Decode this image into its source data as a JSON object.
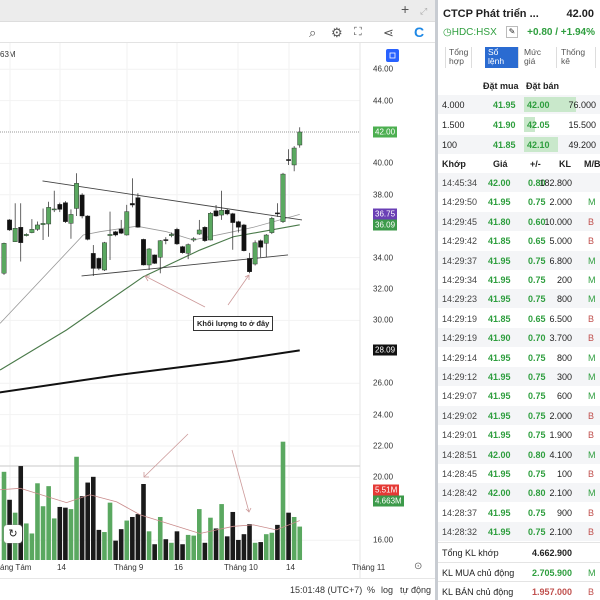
{
  "chart": {
    "volume_legend": "63M",
    "annotation": "Khối lượng to ở đây",
    "price_axis": [
      "46.00",
      "44.00",
      "40.00",
      "38.00",
      "34.00",
      "32.00",
      "30.00",
      "26.00",
      "24.00",
      "22.00",
      "20.00",
      "16.00"
    ],
    "price_axis_values": [
      46,
      44,
      40,
      38,
      34,
      32,
      30,
      26,
      24,
      22,
      20,
      16
    ],
    "badges": [
      {
        "text": "42.00",
        "value": 42.0,
        "color": "#4caf50"
      },
      {
        "text": "36.75",
        "value": 36.75,
        "color": "#6a3fb5"
      },
      {
        "text": "36.09",
        "value": 36.09,
        "color": "#3c9a4a"
      },
      {
        "text": "28.09",
        "value": 28.09,
        "color": "#111111"
      },
      {
        "text": "5.51M",
        "value": 19.2,
        "color": "#e53935"
      },
      {
        "text": "4.663M",
        "value": 18.5,
        "color": "#3c9a4a"
      }
    ],
    "x_axis": [
      "áng Tám",
      "14",
      "Tháng 9",
      "16",
      "Tháng 10",
      "14",
      "Tháng 11"
    ],
    "status": {
      "time": "15:01:48 (UTC+7)",
      "percent": "%",
      "log": "log",
      "auto": "tự động"
    }
  },
  "chart_data": {
    "type": "candlestick",
    "ohlc": [
      [
        33.0,
        34.95,
        32.9,
        34.91
      ],
      [
        36.4,
        36.45,
        35.7,
        35.76
      ],
      [
        35.01,
        37.46,
        35.0,
        35.87
      ],
      [
        35.93,
        37.46,
        33.75,
        34.95
      ],
      [
        35.4,
        35.55,
        35.35,
        35.48
      ],
      [
        35.59,
        36.45,
        35.55,
        35.8
      ],
      [
        35.8,
        36.3,
        35.7,
        36.08
      ],
      [
        36.1,
        37.13,
        35.12,
        36.18
      ],
      [
        36.14,
        37.56,
        35.33,
        37.2
      ],
      [
        37.05,
        38.26,
        36.9,
        37.1
      ],
      [
        37.39,
        37.5,
        36.9,
        37.07
      ],
      [
        37.5,
        37.6,
        36.2,
        36.29
      ],
      [
        36.18,
        37.07,
        35.2,
        36.75
      ],
      [
        37.13,
        39.37,
        36.65,
        38.73
      ],
      [
        37.99,
        38.1,
        36.5,
        36.65
      ],
      [
        36.65,
        36.7,
        35.1,
        35.16
      ],
      [
        34.27,
        34.8,
        32.83,
        33.31
      ],
      [
        33.95,
        34.0,
        33.2,
        33.31
      ],
      [
        33.21,
        35.0,
        33.15,
        34.95
      ],
      [
        35.4,
        36.93,
        33.85,
        35.48
      ],
      [
        35.65,
        35.7,
        35.35,
        35.44
      ],
      [
        35.82,
        36.4,
        35.5,
        35.55
      ],
      [
        35.44,
        37.36,
        35.4,
        36.93
      ],
      [
        37.45,
        39.05,
        37.2,
        37.35
      ],
      [
        37.82,
        38.1,
        35.9,
        35.93
      ],
      [
        35.16,
        35.2,
        33.5,
        33.53
      ],
      [
        33.53,
        34.6,
        33.21,
        34.55
      ],
      [
        34.17,
        34.2,
        33.6,
        33.63
      ],
      [
        34.02,
        35.12,
        33.0,
        35.08
      ],
      [
        35.15,
        35.3,
        34.85,
        35.08
      ],
      [
        35.4,
        35.6,
        35.3,
        35.48
      ],
      [
        35.8,
        35.9,
        34.8,
        34.87
      ],
      [
        34.7,
        34.75,
        34.25,
        34.31
      ],
      [
        34.27,
        34.9,
        33.9,
        34.83
      ],
      [
        35.12,
        35.3,
        35.0,
        35.2
      ],
      [
        35.5,
        36.4,
        35.45,
        35.76
      ],
      [
        35.93,
        36.0,
        35.0,
        35.08
      ],
      [
        35.12,
        36.9,
        35.1,
        36.82
      ],
      [
        36.98,
        37.35,
        36.6,
        36.65
      ],
      [
        36.71,
        38.26,
        36.4,
        37.02
      ],
      [
        37.02,
        37.1,
        36.7,
        36.78
      ],
      [
        36.8,
        36.85,
        34.5,
        36.23
      ],
      [
        36.29,
        36.35,
        35.6,
        35.93
      ],
      [
        36.08,
        36.15,
        34.4,
        34.44
      ],
      [
        33.95,
        34.3,
        33.0,
        33.1
      ],
      [
        33.59,
        35.1,
        33.5,
        34.95
      ],
      [
        35.08,
        35.15,
        34.02,
        34.66
      ],
      [
        34.91,
        35.5,
        34.02,
        35.44
      ],
      [
        35.59,
        36.6,
        35.5,
        36.5
      ],
      [
        36.85,
        37.46,
        36.6,
        36.78
      ],
      [
        36.29,
        39.4,
        36.2,
        39.32
      ],
      [
        40.25,
        40.9,
        39.9,
        40.18
      ],
      [
        39.9,
        41.1,
        39.5,
        40.98
      ],
      [
        41.17,
        42.3,
        41.0,
        42.0
      ]
    ],
    "volume_millions": [
      12.3,
      8.4,
      6.6,
      13.1,
      5.1,
      3.7,
      10.7,
      7.5,
      10.3,
      5.8,
      7.4,
      7.3,
      7.1,
      14.4,
      8.9,
      10.8,
      11.6,
      4.2,
      3.9,
      8.0,
      2.7,
      4.3,
      5.5,
      6.0,
      6.4,
      10.6,
      4.0,
      2.2,
      6.0,
      2.9,
      2.4,
      4.0,
      2.2,
      3.5,
      3.4,
      7.1,
      2.4,
      5.9,
      4.4,
      7.8,
      3.3,
      6.7,
      2.8,
      3.6,
      5.0,
      2.4,
      2.5,
      3.6,
      3.8,
      4.9,
      16.5,
      6.6,
      6.0,
      4.66
    ],
    "volume_up": [
      1,
      0,
      1,
      0,
      1,
      1,
      1,
      1,
      1,
      1,
      0,
      0,
      1,
      1,
      0,
      0,
      0,
      0,
      1,
      1,
      0,
      0,
      1,
      0,
      0,
      0,
      1,
      0,
      1,
      0,
      1,
      0,
      0,
      1,
      1,
      1,
      0,
      1,
      0,
      1,
      0,
      0,
      0,
      0,
      0,
      1,
      0,
      1,
      1,
      0,
      1,
      0,
      1,
      1
    ],
    "ma_short": [
      [
        -0.7,
        29.81
      ],
      [
        14.2,
        35.44
      ],
      [
        17.2,
        35.65
      ],
      [
        23.8,
        36.0
      ],
      [
        29.1,
        35.65
      ],
      [
        33.9,
        35.12
      ],
      [
        41.1,
        35.65
      ],
      [
        44.7,
        35.93
      ],
      [
        53,
        36.75
      ]
    ],
    "ma_mid": [
      [
        -0.7,
        26.84
      ],
      [
        11.2,
        29.39
      ],
      [
        25,
        32.79
      ],
      [
        35.1,
        34.48
      ],
      [
        41.1,
        35.33
      ],
      [
        53,
        36.09
      ]
    ],
    "ma_long": [
      [
        -1,
        25.4
      ],
      [
        20,
        26.5
      ],
      [
        40,
        27.4
      ],
      [
        53,
        28.09
      ]
    ],
    "volume_ma": [
      [
        -0.7,
        9.8
      ],
      [
        2.9,
        10.0
      ],
      [
        11.2,
        8.0
      ],
      [
        15.4,
        9.1
      ],
      [
        20.2,
        8.1
      ],
      [
        24.4,
        6.3
      ],
      [
        27.3,
        5.6
      ],
      [
        35.1,
        3.7
      ],
      [
        41.1,
        4.7
      ],
      [
        44.7,
        4.9
      ],
      [
        48.8,
        4.2
      ],
      [
        53,
        5.5
      ]
    ],
    "trendlines": [
      [
        [
          6.9,
          38.88
        ],
        [
          53.4,
          36.4
        ]
      ],
      [
        [
          13.9,
          32.83
        ],
        [
          50.9,
          34.17
        ]
      ]
    ],
    "last_price_line": 42.0,
    "ylim": [
      15.5,
      47
    ]
  },
  "panel": {
    "title": "CTCP Phát triển ...",
    "price": "42.00",
    "ticker": "HDC:HSX",
    "change": "+0.80 / +1.94%",
    "tabs": [
      {
        "l1": "Tổng",
        "l2": "hợp"
      },
      {
        "l1": "Sổ",
        "l2": "lệnh"
      },
      {
        "l1": "Mức",
        "l2": "giá"
      },
      {
        "l1": "Thống",
        "l2": "kê"
      }
    ],
    "book_headers": {
      "bid": "Đặt mua",
      "ask": "Đặt bán"
    },
    "book": [
      {
        "bid_qty": "4.000",
        "bid": "41.95",
        "ask": "42.00",
        "ask_qty": "76.000",
        "ask_qty_num": 76000
      },
      {
        "bid_qty": "1.500",
        "bid": "41.90",
        "ask": "42.05",
        "ask_qty": "15.500",
        "ask_qty_num": 15500
      },
      {
        "bid_qty": "100",
        "bid": "41.85",
        "ask": "42.10",
        "ask_qty": "49.200",
        "ask_qty_num": 49200
      }
    ],
    "trade_headers": {
      "time": "Khớp",
      "price": "Giá",
      "chg": "+/-",
      "vol": "KL",
      "side": "M/B"
    },
    "trades": [
      {
        "t": "14:45:34",
        "p": "42.00",
        "c": "0.80",
        "v": "182.800",
        "s": ""
      },
      {
        "t": "14:29:50",
        "p": "41.95",
        "c": "0.75",
        "v": "2.000",
        "s": "M"
      },
      {
        "t": "14:29:45",
        "p": "41.80",
        "c": "0.60",
        "v": "10.000",
        "s": "B"
      },
      {
        "t": "14:29:42",
        "p": "41.85",
        "c": "0.65",
        "v": "5.000",
        "s": "B"
      },
      {
        "t": "14:29:37",
        "p": "41.95",
        "c": "0.75",
        "v": "6.800",
        "s": "M"
      },
      {
        "t": "14:29:34",
        "p": "41.95",
        "c": "0.75",
        "v": "200",
        "s": "M"
      },
      {
        "t": "14:29:23",
        "p": "41.95",
        "c": "0.75",
        "v": "800",
        "s": "M"
      },
      {
        "t": "14:29:19",
        "p": "41.85",
        "c": "0.65",
        "v": "6.500",
        "s": "B"
      },
      {
        "t": "14:29:19",
        "p": "41.90",
        "c": "0.70",
        "v": "3.700",
        "s": "B"
      },
      {
        "t": "14:29:14",
        "p": "41.95",
        "c": "0.75",
        "v": "800",
        "s": "M"
      },
      {
        "t": "14:29:12",
        "p": "41.95",
        "c": "0.75",
        "v": "300",
        "s": "M"
      },
      {
        "t": "14:29:07",
        "p": "41.95",
        "c": "0.75",
        "v": "600",
        "s": "M"
      },
      {
        "t": "14:29:02",
        "p": "41.95",
        "c": "0.75",
        "v": "2.000",
        "s": "B"
      },
      {
        "t": "14:29:01",
        "p": "41.95",
        "c": "0.75",
        "v": "1.900",
        "s": "B"
      },
      {
        "t": "14:28:51",
        "p": "42.00",
        "c": "0.80",
        "v": "4.100",
        "s": "M"
      },
      {
        "t": "14:28:45",
        "p": "41.95",
        "c": "0.75",
        "v": "100",
        "s": "B"
      },
      {
        "t": "14:28:42",
        "p": "42.00",
        "c": "0.80",
        "v": "2.100",
        "s": "M"
      },
      {
        "t": "14:28:37",
        "p": "41.95",
        "c": "0.75",
        "v": "900",
        "s": "B"
      },
      {
        "t": "14:28:32",
        "p": "41.95",
        "c": "0.75",
        "v": "2.100",
        "s": "B"
      }
    ],
    "summary": [
      {
        "label": "Tổng KL khớp",
        "value": "4.662.900",
        "side": ""
      },
      {
        "label": "KL MUA chủ động",
        "value": "2.705.900",
        "side": "M"
      },
      {
        "label": "KL BÁN chủ động",
        "value": "1.957.000",
        "side": "B"
      }
    ]
  }
}
